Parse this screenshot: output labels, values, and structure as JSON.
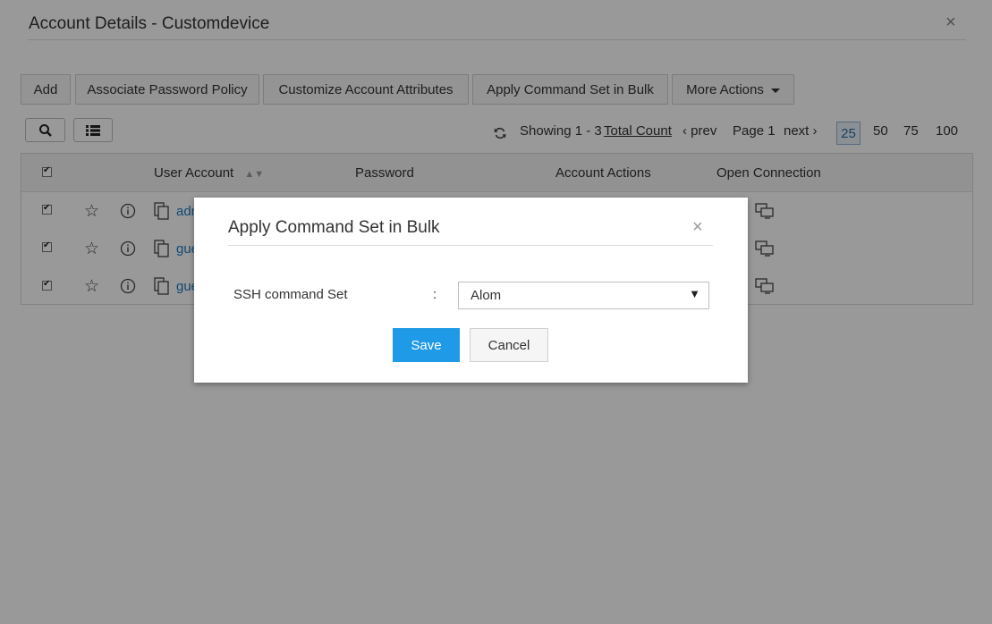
{
  "page": {
    "title": "Account Details - Customdevice",
    "close": "×"
  },
  "toolbar": {
    "add": "Add",
    "associate_policy": "Associate Password Policy",
    "customize_attributes": "Customize Account Attributes",
    "apply_command_set": "Apply Command Set in Bulk",
    "more_actions": "More Actions"
  },
  "pager": {
    "showing": "Showing 1 - 3",
    "total_count": "Total Count",
    "prev": "prev",
    "page": "Page 1",
    "next": "next",
    "sizes": [
      "25",
      "50",
      "75",
      "100"
    ],
    "active_size": "25"
  },
  "grid": {
    "columns": {
      "user_account": "User Account",
      "password": "Password",
      "account_actions": "Account Actions",
      "open_connection": "Open Connection"
    },
    "rows": [
      {
        "account": "adm"
      },
      {
        "account": "gue"
      },
      {
        "account": "gue"
      }
    ]
  },
  "modal": {
    "title": "Apply Command Set in Bulk",
    "close": "×",
    "field_label": "SSH command Set",
    "colon": ":",
    "selected": "Alom",
    "save": "Save",
    "cancel": "Cancel"
  },
  "colors": {
    "accent": "#1e9ae6",
    "link": "#1e79c0"
  }
}
